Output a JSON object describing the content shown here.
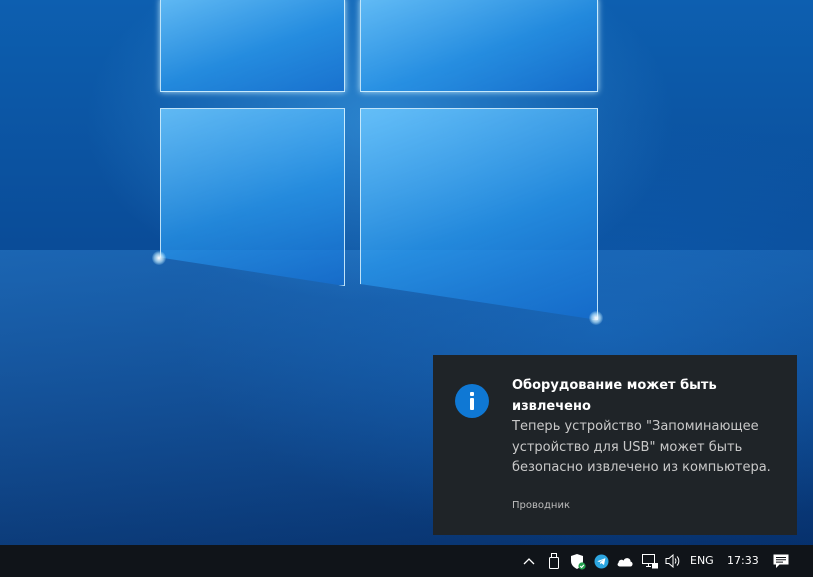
{
  "notification": {
    "icon": "info-icon",
    "title": "Оборудование может быть извлечено",
    "body": "Теперь устройство \"Запоминающее устройство для USB\" может быть безопасно извлечено из компьютера.",
    "source": "Проводник",
    "accent_color": "#0f78d4",
    "background_color": "#1f2428"
  },
  "taskbar": {
    "tray_icons": [
      "chevron-up-icon",
      "usb-drive-icon",
      "windows-security-icon",
      "telegram-icon",
      "onedrive-icon",
      "network-icon",
      "volume-icon"
    ],
    "language": "ENG",
    "time": "17:33",
    "action_center_icon": "action-center-icon",
    "background_color": "#101419"
  }
}
